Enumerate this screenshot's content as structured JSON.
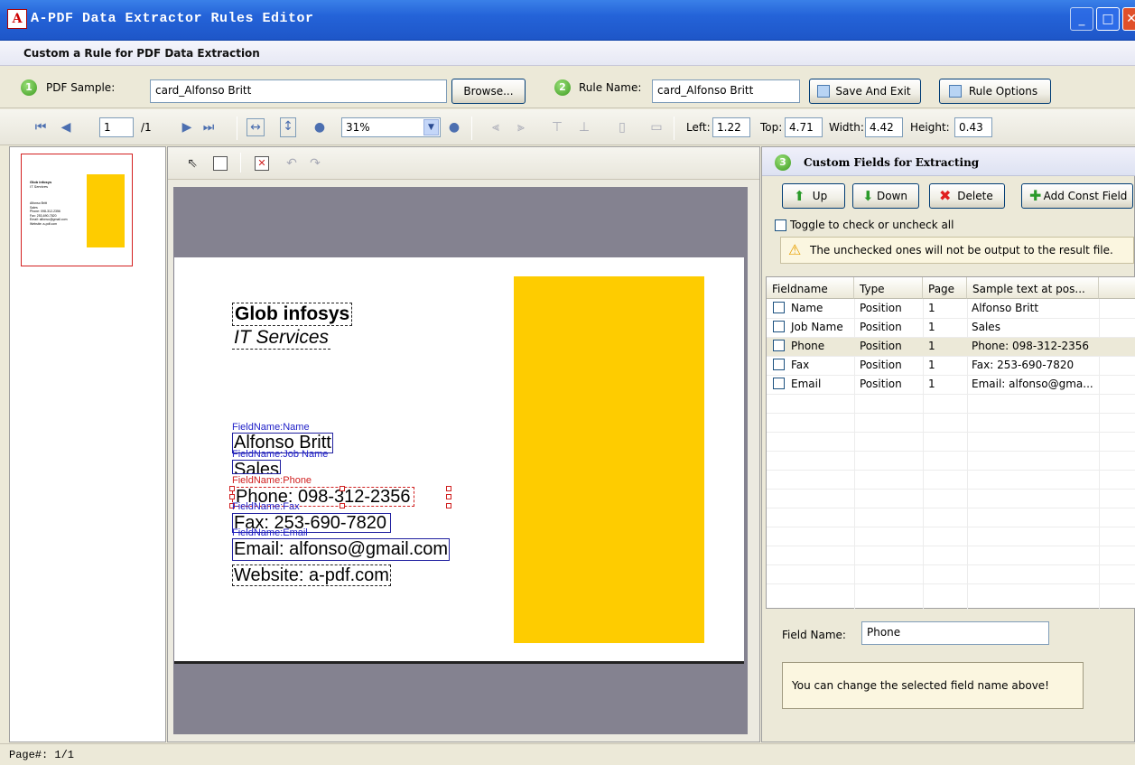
{
  "window": {
    "title": "A-PDF Data Extractor Rules Editor",
    "app_icon": "pdf-app-icon"
  },
  "subtitle": "Custom a Rule for PDF Data Extraction",
  "sample": {
    "step": "1",
    "label": "PDF Sample:",
    "value": "card_Alfonso Britt",
    "browse_label": "Browse...",
    "rule_step": "2",
    "rule_label": "Rule Name:",
    "rule_value": "card_Alfonso Britt",
    "save_label": "Save And Exit",
    "options_label": "Rule Options"
  },
  "toolbar": {
    "page_value": "1",
    "page_total": "/1",
    "zoom": "31%",
    "left_label": "Left:",
    "left_value": "1.22",
    "top_label": "Top:",
    "top_value": "4.71",
    "width_label": "Width:",
    "width_value": "4.42",
    "height_label": "Height:",
    "height_value": "0.43"
  },
  "thumb": {
    "line1": "Glob infosys",
    "line2": "IT Services",
    "details": [
      "Alfonso Britt",
      "Sales",
      "Phone: 098-312-2356",
      "Fax: 253-690-7820",
      "Email: alfonso@gmail.com",
      "Website: a-pdf.com"
    ]
  },
  "pdf": {
    "company": "Glob infosys",
    "tagline": "IT Services",
    "name": "Alfonso Britt",
    "job": "Sales",
    "phone": "Phone: 098-312-2356",
    "fax": "Fax: 253-690-7820",
    "email": "Email: alfonso@gmail.com",
    "website": "Website: a-pdf.com",
    "label_name": "FieldName:Name",
    "label_job": "FieldName:Job Name",
    "label_phone": "FieldName:Phone",
    "label_fax": "FieldName:Fax",
    "label_email": "FieldName:Email",
    "accent_color": "#fecc00"
  },
  "fields_panel": {
    "step": "3",
    "title": "Custom Fields for Extracting",
    "up_label": "Up",
    "down_label": "Down",
    "delete_label": "Delete",
    "add_const_label": "Add Const Field",
    "toggle_label": "Toggle to check or uncheck all",
    "warning": "The unchecked ones will not be output to the result file.",
    "columns": [
      "Fieldname",
      "Type",
      "Page",
      "Sample text at pos..."
    ],
    "rows": [
      {
        "name": "Name",
        "type": "Position",
        "page": "1",
        "sample": "Alfonso Britt"
      },
      {
        "name": "Job Name",
        "type": "Position",
        "page": "1",
        "sample": "Sales"
      },
      {
        "name": "Phone",
        "type": "Position",
        "page": "1",
        "sample": "Phone: 098-312-2356"
      },
      {
        "name": "Fax",
        "type": "Position",
        "page": "1",
        "sample": "Fax: 253-690-7820"
      },
      {
        "name": "Email",
        "type": "Position",
        "page": "1",
        "sample": "Email: alfonso@gma..."
      }
    ],
    "field_name_label": "Field Name:",
    "field_name_value": "Phone",
    "hint": "You can change the selected field name above!"
  },
  "status": "Page#:  1/1"
}
